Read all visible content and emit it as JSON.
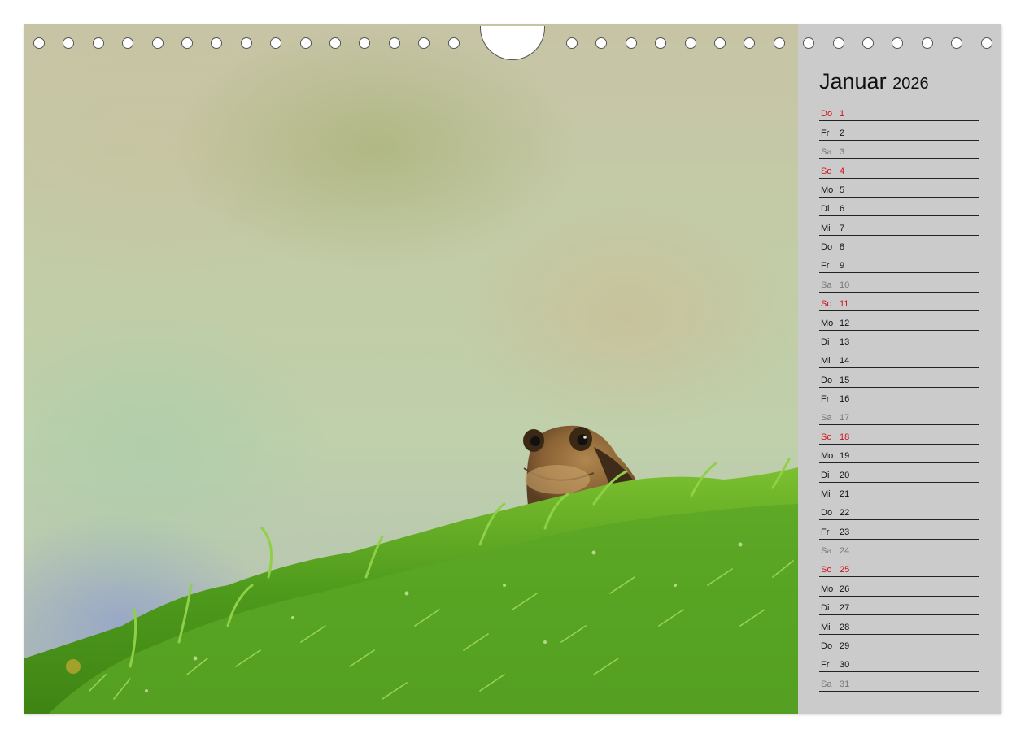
{
  "calendar": {
    "month": "Januar",
    "year": "2026",
    "days": [
      {
        "wd": "Do",
        "num": "1",
        "type": "sun"
      },
      {
        "wd": "Fr",
        "num": "2",
        "type": "week"
      },
      {
        "wd": "Sa",
        "num": "3",
        "type": "sat"
      },
      {
        "wd": "So",
        "num": "4",
        "type": "sun"
      },
      {
        "wd": "Mo",
        "num": "5",
        "type": "week"
      },
      {
        "wd": "Di",
        "num": "6",
        "type": "week"
      },
      {
        "wd": "Mi",
        "num": "7",
        "type": "week"
      },
      {
        "wd": "Do",
        "num": "8",
        "type": "week"
      },
      {
        "wd": "Fr",
        "num": "9",
        "type": "week"
      },
      {
        "wd": "Sa",
        "num": "10",
        "type": "sat"
      },
      {
        "wd": "So",
        "num": "11",
        "type": "sun"
      },
      {
        "wd": "Mo",
        "num": "12",
        "type": "week"
      },
      {
        "wd": "Di",
        "num": "13",
        "type": "week"
      },
      {
        "wd": "Mi",
        "num": "14",
        "type": "week"
      },
      {
        "wd": "Do",
        "num": "15",
        "type": "week"
      },
      {
        "wd": "Fr",
        "num": "16",
        "type": "week"
      },
      {
        "wd": "Sa",
        "num": "17",
        "type": "sat"
      },
      {
        "wd": "So",
        "num": "18",
        "type": "sun"
      },
      {
        "wd": "Mo",
        "num": "19",
        "type": "week"
      },
      {
        "wd": "Di",
        "num": "20",
        "type": "week"
      },
      {
        "wd": "Mi",
        "num": "21",
        "type": "week"
      },
      {
        "wd": "Do",
        "num": "22",
        "type": "week"
      },
      {
        "wd": "Fr",
        "num": "23",
        "type": "week"
      },
      {
        "wd": "Sa",
        "num": "24",
        "type": "sat"
      },
      {
        "wd": "So",
        "num": "25",
        "type": "sun"
      },
      {
        "wd": "Mo",
        "num": "26",
        "type": "week"
      },
      {
        "wd": "Di",
        "num": "27",
        "type": "week"
      },
      {
        "wd": "Mi",
        "num": "28",
        "type": "week"
      },
      {
        "wd": "Do",
        "num": "29",
        "type": "week"
      },
      {
        "wd": "Fr",
        "num": "30",
        "type": "week"
      },
      {
        "wd": "Sa",
        "num": "31",
        "type": "sat"
      }
    ]
  },
  "colors": {
    "sunday": "#d0141e",
    "saturday": "#777777",
    "weekday": "#111111",
    "panel": "#cbcbcb",
    "moss": "#5fa321"
  },
  "icons": {
    "binding": "wire-binding-hole-icon",
    "hanger": "hanger-notch-icon"
  }
}
